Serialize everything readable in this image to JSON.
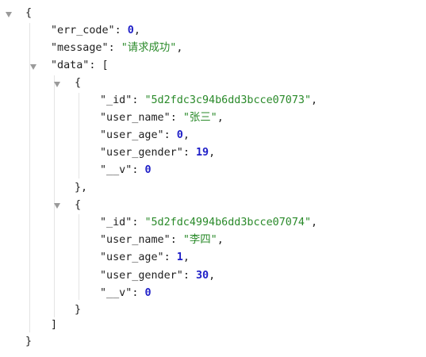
{
  "colors": {
    "string": "#2a8a2a",
    "number": "#2020c8",
    "text": "#1f1f1f",
    "toggle": "#9a9a9a",
    "guide": "#e4e4e4"
  },
  "icons": {
    "toggle": "collapse-triangle-icon"
  },
  "json": {
    "err_code": {
      "key": "\"err_code\"",
      "value": "0"
    },
    "message": {
      "key": "\"message\"",
      "value": "\"请求成功\""
    },
    "data": {
      "key": "\"data\"",
      "items": [
        {
          "_id": {
            "key": "\"_id\"",
            "value": "\"5d2fdc3c94b6dd3bcce07073\""
          },
          "user_name": {
            "key": "\"user_name\"",
            "value": "\"张三\""
          },
          "user_age": {
            "key": "\"user_age\"",
            "value": "0"
          },
          "user_gender": {
            "key": "\"user_gender\"",
            "value": "19"
          },
          "__v": {
            "key": "\"__v\"",
            "value": "0"
          }
        },
        {
          "_id": {
            "key": "\"_id\"",
            "value": "\"5d2fdc4994b6dd3bcce07074\""
          },
          "user_name": {
            "key": "\"user_name\"",
            "value": "\"李四\""
          },
          "user_age": {
            "key": "\"user_age\"",
            "value": "1"
          },
          "user_gender": {
            "key": "\"user_gender\"",
            "value": "30"
          },
          "__v": {
            "key": "\"__v\"",
            "value": "0"
          }
        }
      ]
    }
  }
}
